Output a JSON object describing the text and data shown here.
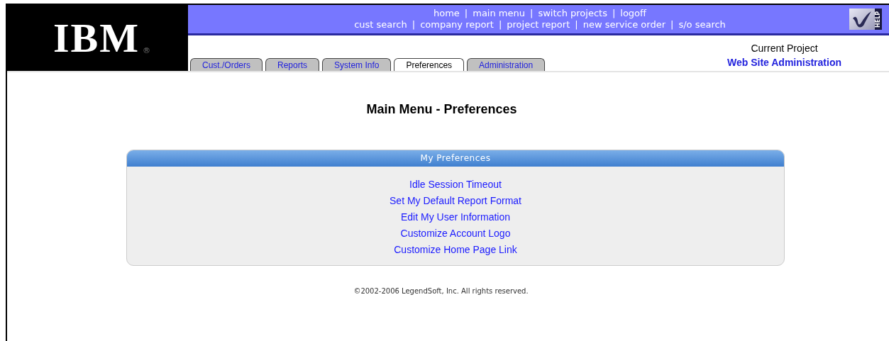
{
  "logo": {
    "text": "IBM",
    "mark": "®"
  },
  "top_links": [
    [
      "home",
      "main menu",
      "switch projects",
      "logoff"
    ],
    [
      "cust search",
      "company report",
      "project report",
      "new service order",
      "s/o search"
    ]
  ],
  "link_separator": "|",
  "help": {
    "label": "HELP"
  },
  "tabs": [
    {
      "label": "Cust./Orders",
      "selected": false
    },
    {
      "label": "Reports",
      "selected": false
    },
    {
      "label": "System Info",
      "selected": false
    },
    {
      "label": "Preferences",
      "selected": true
    },
    {
      "label": "Administration",
      "selected": false
    }
  ],
  "current_project": {
    "label": "Current Project",
    "value": "Web Site Administration"
  },
  "page_title": "Main Menu - Preferences",
  "panel": {
    "title": "My Preferences",
    "links": [
      "Idle Session Timeout",
      "Set My Default Report Format",
      "Edit My User Information",
      "Customize Account Logo",
      "Customize Home Page Link"
    ]
  },
  "footer": "©2002-2006 LegendSoft, Inc. All rights reserved."
}
